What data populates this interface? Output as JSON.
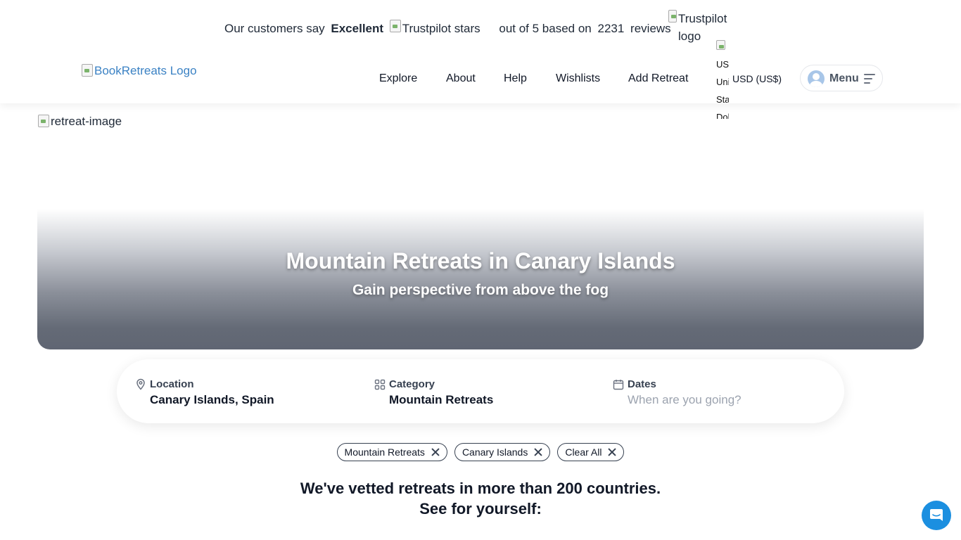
{
  "trustpilot": {
    "prefix": "Our customers say",
    "rating_word": "Excellent",
    "stars_alt": "Trustpilot stars",
    "out_of": "out of 5 based on",
    "review_count": "2231",
    "reviews_word": "reviews",
    "logo_alt": "Trustpilot logo"
  },
  "header": {
    "logo_alt": "BookRetreats Logo",
    "nav": [
      "Explore",
      "About",
      "Help",
      "Wishlists",
      "Add Retreat"
    ],
    "flag_alt": "US United States Dollar",
    "currency": "USD (US$)",
    "menu_label": "Menu"
  },
  "hero": {
    "image_alt": "retreat-image",
    "title": "Mountain Retreats in Canary Islands",
    "subtitle": "Gain perspective from above the fog"
  },
  "search": {
    "location_label": "Location",
    "location_value": "Canary Islands, Spain",
    "category_label": "Category",
    "category_value": "Mountain Retreats",
    "dates_label": "Dates",
    "dates_placeholder": "When are you going?"
  },
  "chips": [
    "Mountain Retreats",
    "Canary Islands",
    "Clear All"
  ],
  "vetted": {
    "line1": "We've vetted retreats in more than 200 countries.",
    "line2": "See for yourself:"
  },
  "colors": {
    "accent": "#1b8fe0",
    "hero_dark": "#606673"
  }
}
